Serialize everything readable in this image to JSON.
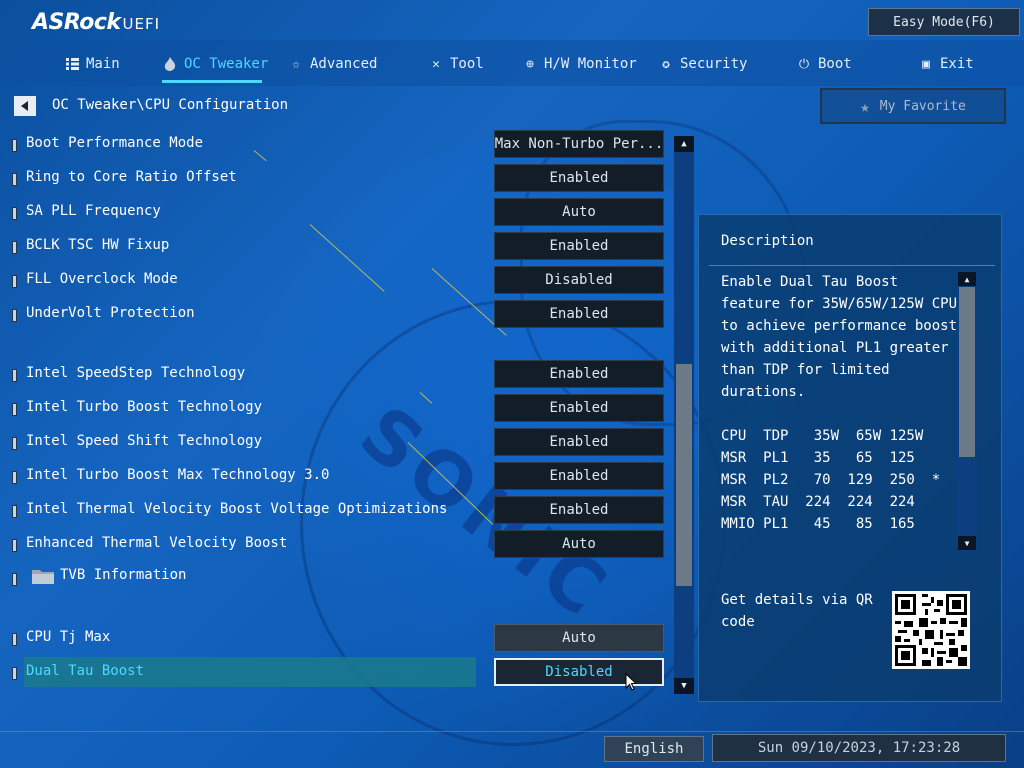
{
  "brand": {
    "logo": "ASRock",
    "suffix": "UEFI"
  },
  "header": {
    "easy_mode": "Easy Mode(F6)"
  },
  "tabs": [
    {
      "label": "Main",
      "icon": "list-icon"
    },
    {
      "label": "OC Tweaker",
      "icon": "flame-icon",
      "active": true
    },
    {
      "label": "Advanced",
      "icon": "star-icon"
    },
    {
      "label": "Tool",
      "icon": "tools-icon"
    },
    {
      "label": "H/W Monitor",
      "icon": "monitor-icon"
    },
    {
      "label": "Security",
      "icon": "shield-icon"
    },
    {
      "label": "Boot",
      "icon": "power-icon"
    },
    {
      "label": "Exit",
      "icon": "exit-icon"
    }
  ],
  "breadcrumb": "OC Tweaker\\CPU Configuration",
  "favorite": "My Favorite",
  "settings": [
    {
      "label": "Boot Performance Mode",
      "value": "Max Non-Turbo Per..."
    },
    {
      "label": "Ring to Core Ratio Offset",
      "value": "Enabled"
    },
    {
      "label": "SA PLL Frequency",
      "value": "Auto"
    },
    {
      "label": "BCLK TSC HW Fixup",
      "value": "Enabled"
    },
    {
      "label": "FLL Overclock Mode",
      "value": "Disabled"
    },
    {
      "label": "UnderVolt Protection",
      "value": "Enabled"
    },
    {
      "label": "Intel SpeedStep Technology",
      "value": "Enabled"
    },
    {
      "label": "Intel Turbo Boost Technology",
      "value": "Enabled"
    },
    {
      "label": "Intel Speed Shift Technology",
      "value": "Enabled"
    },
    {
      "label": "Intel Turbo Boost Max Technology 3.0",
      "value": "Enabled"
    },
    {
      "label": "Intel Thermal Velocity Boost Voltage Optimizations",
      "value": "Enabled"
    },
    {
      "label": "Enhanced Thermal Velocity Boost",
      "value": "Auto"
    },
    {
      "label": "TVB Information",
      "value": ""
    },
    {
      "label": "CPU Tj Max",
      "value": "Auto"
    },
    {
      "label": "Dual Tau Boost",
      "value": "Disabled",
      "selected": true
    }
  ],
  "description": {
    "title": "Description",
    "body": "Enable Dual Tau Boost\nfeature for 35W/65W/125W CPU\nto achieve performance boost\nwith additional PL1 greater\nthan TDP for limited\ndurations.\n\nCPU  TDP   35W  65W 125W\nMSR  PL1   35   65  125\nMSR  PL2   70  129  250  *\nMSR  TAU  224  224  224\nMMIO PL1   45   85  165",
    "qr_text": "Get details via QR code"
  },
  "footer": {
    "language": "English",
    "datetime": "Sun 09/10/2023, 17:23:28"
  },
  "colors": {
    "accent": "#4fd7ff",
    "background": "#1565c0",
    "selected_row": "#1b7a8c"
  }
}
